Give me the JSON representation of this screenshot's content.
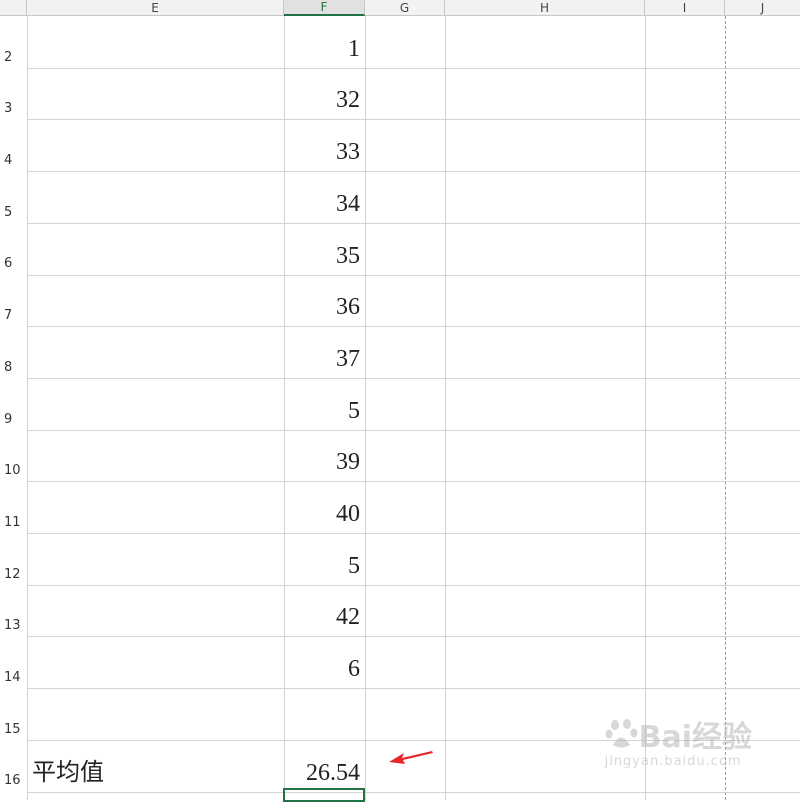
{
  "columns": [
    {
      "label": "E"
    },
    {
      "label": "F"
    },
    {
      "label": "G"
    },
    {
      "label": "H"
    },
    {
      "label": "I"
    },
    {
      "label": "J"
    }
  ],
  "rows": [
    {
      "num": "2",
      "f": "1"
    },
    {
      "num": "3",
      "f": "32"
    },
    {
      "num": "4",
      "f": "33"
    },
    {
      "num": "5",
      "f": "34"
    },
    {
      "num": "6",
      "f": "35"
    },
    {
      "num": "7",
      "f": "36"
    },
    {
      "num": "8",
      "f": "37"
    },
    {
      "num": "9",
      "f": "5"
    },
    {
      "num": "10",
      "f": "39"
    },
    {
      "num": "11",
      "f": "40"
    },
    {
      "num": "12",
      "f": "5"
    },
    {
      "num": "13",
      "f": "42"
    },
    {
      "num": "14",
      "f": "6"
    },
    {
      "num": "15",
      "f": ""
    },
    {
      "num": "16",
      "e": "平均值",
      "f": "26.54"
    }
  ],
  "active_column": "F",
  "colors": {
    "accent": "#217346",
    "arrow": "#e8262a"
  },
  "icons": {
    "annotation": "red-arrow-icon",
    "watermark_logo": "baidu-paw-icon"
  },
  "watermark": {
    "brand": "Bai经验",
    "sub": "jingyan.baidu.com"
  }
}
